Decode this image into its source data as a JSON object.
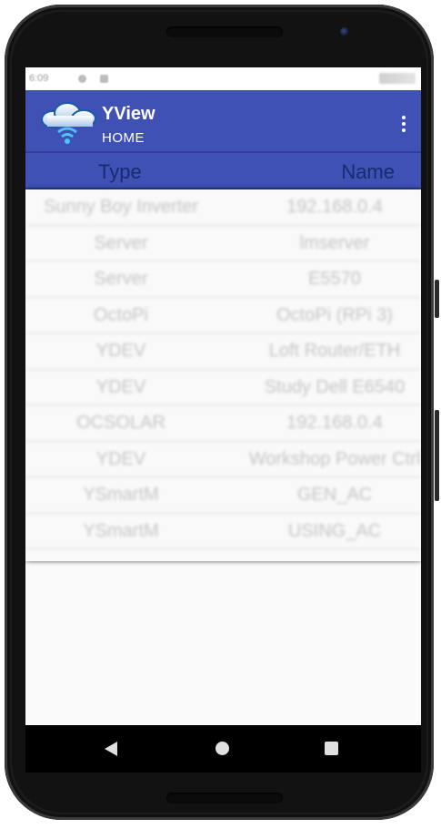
{
  "status_bar": {
    "time": "6:09"
  },
  "app_bar": {
    "title": "YView",
    "subtitle": "HOME",
    "logo_icon": "cloud-wifi-icon",
    "menu_icon": "more-vert-icon",
    "background": "#3f51b5"
  },
  "table": {
    "columns": [
      "Type",
      "Name"
    ],
    "rows": [
      {
        "type": "Sunny Boy Inverter",
        "name": "192.168.0.4"
      },
      {
        "type": "Server",
        "name": "lmserver"
      },
      {
        "type": "Server",
        "name": "E5570"
      },
      {
        "type": "OctoPi",
        "name": "OctoPi (RPi 3)"
      },
      {
        "type": "YDEV",
        "name": "Loft Router/ETH"
      },
      {
        "type": "YDEV",
        "name": "Study Dell E6540"
      },
      {
        "type": "OCSOLAR",
        "name": "192.168.0.4"
      },
      {
        "type": "YDEV",
        "name": "Workshop Power Ctrl"
      },
      {
        "type": "YSmartM",
        "name": "GEN_AC"
      },
      {
        "type": "YSmartM",
        "name": "USING_AC"
      }
    ]
  },
  "nav_bar": {
    "back_icon": "back-triangle-icon",
    "home_icon": "home-circle-icon",
    "recent_icon": "recents-square-icon"
  }
}
